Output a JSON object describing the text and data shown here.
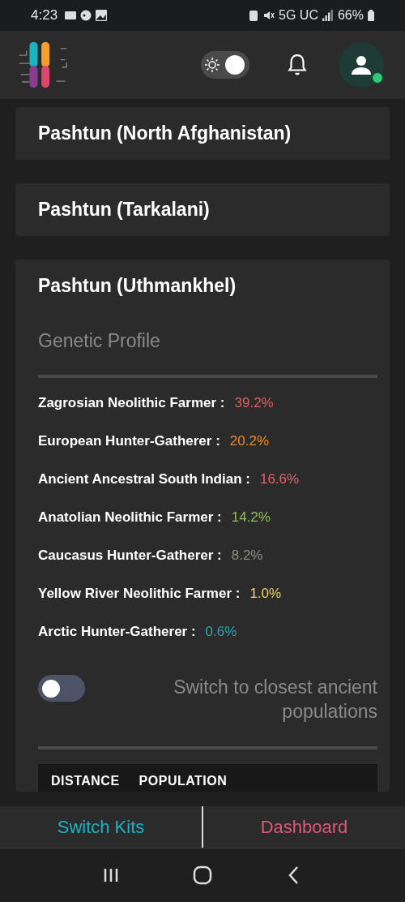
{
  "status_bar": {
    "time": "4:23",
    "network": "5G UC",
    "battery": "66%"
  },
  "header": {
    "theme_toggle": {
      "on": true
    },
    "avatar": {
      "online": true
    }
  },
  "cards": [
    {
      "title": "Pashtun (North Afghanistan)",
      "expanded": false
    },
    {
      "title": "Pashtun (Tarkalani)",
      "expanded": false
    },
    {
      "title": "Pashtun (Uthmankhel)",
      "expanded": true,
      "section": "Genetic Profile",
      "components": [
        {
          "name": "Zagrosian Neolithic Farmer :",
          "value": "39.2%",
          "color": "#e45c5c"
        },
        {
          "name": "European Hunter-Gatherer :",
          "value": "20.2%",
          "color": "#f08a24"
        },
        {
          "name": "Ancient Ancestral South Indian :",
          "value": "16.6%",
          "color": "#e0636b"
        },
        {
          "name": "Anatolian Neolithic Farmer :",
          "value": "14.2%",
          "color": "#8fbf5a"
        },
        {
          "name": "Caucasus Hunter-Gatherer :",
          "value": "8.2%",
          "color": "#8e8a80"
        },
        {
          "name": "Yellow River Neolithic Farmer :",
          "value": "1.0%",
          "color": "#f2d35a"
        },
        {
          "name": "Arctic Hunter-Gatherer :",
          "value": "0.6%",
          "color": "#2ba7b4"
        }
      ],
      "switch": {
        "label": "Switch to closest ancient populations",
        "on": false
      },
      "table": {
        "columns": [
          "DISTANCE",
          "POPULATION"
        ]
      }
    }
  ],
  "bottom_bar": {
    "left": "Switch Kits",
    "right": "Dashboard"
  }
}
